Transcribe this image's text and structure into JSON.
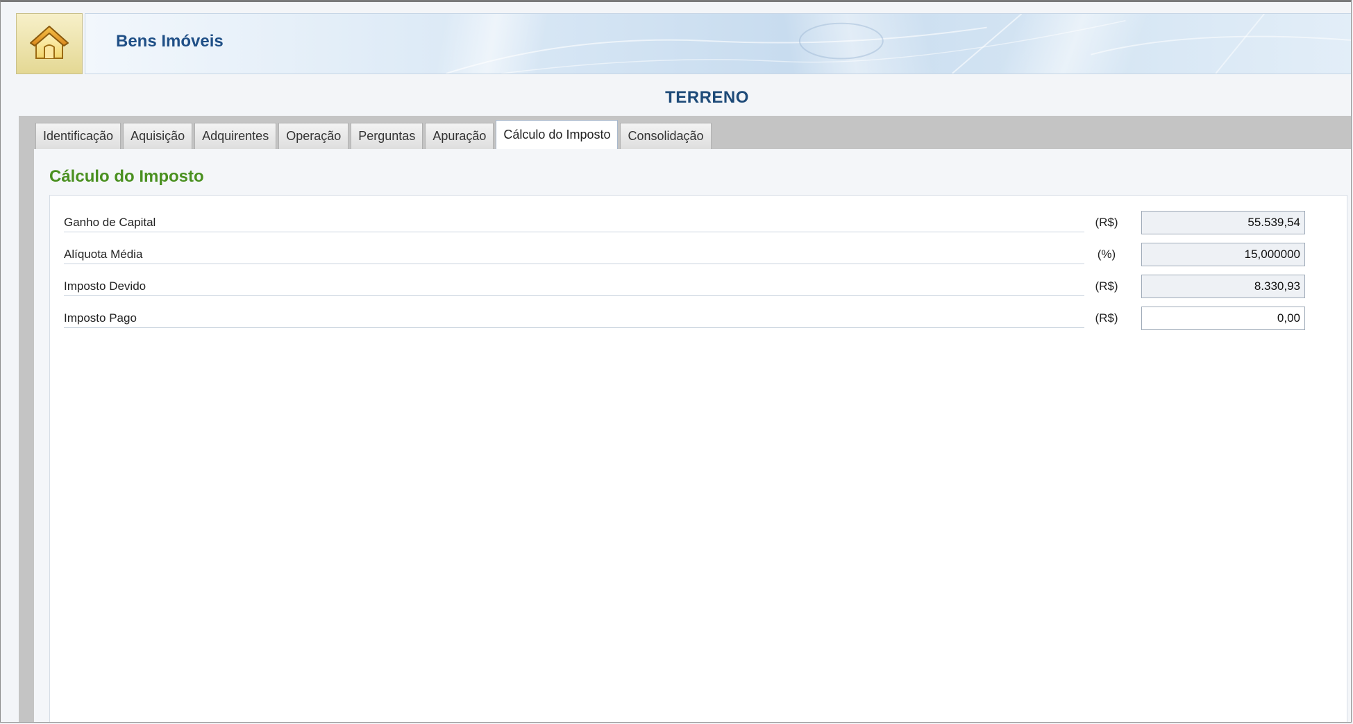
{
  "header": {
    "icon": "home-icon",
    "app_title": "Bens Imóveis"
  },
  "record_title": "TERRENO",
  "tabs": [
    {
      "label": "Identificação",
      "active": false
    },
    {
      "label": "Aquisição",
      "active": false
    },
    {
      "label": "Adquirentes",
      "active": false
    },
    {
      "label": "Operação",
      "active": false
    },
    {
      "label": "Perguntas",
      "active": false
    },
    {
      "label": "Apuração",
      "active": false
    },
    {
      "label": "Cálculo do Imposto",
      "active": true
    },
    {
      "label": "Consolidação",
      "active": false
    }
  ],
  "section_title": "Cálculo do Imposto",
  "fields": [
    {
      "label": "Ganho de Capital",
      "unit": "(R$)",
      "value": "55.539,54",
      "editable": false
    },
    {
      "label": "Alíquota Média",
      "unit": "(%)",
      "value": "15,000000",
      "editable": false
    },
    {
      "label": "Imposto Devido",
      "unit": "(R$)",
      "value": "8.330,93",
      "editable": false
    },
    {
      "label": "Imposto Pago",
      "unit": "(R$)",
      "value": "0,00",
      "editable": true
    }
  ],
  "colors": {
    "app_title": "#1f4f86",
    "section_title": "#4a9020",
    "record_title": "#1d4a78"
  }
}
